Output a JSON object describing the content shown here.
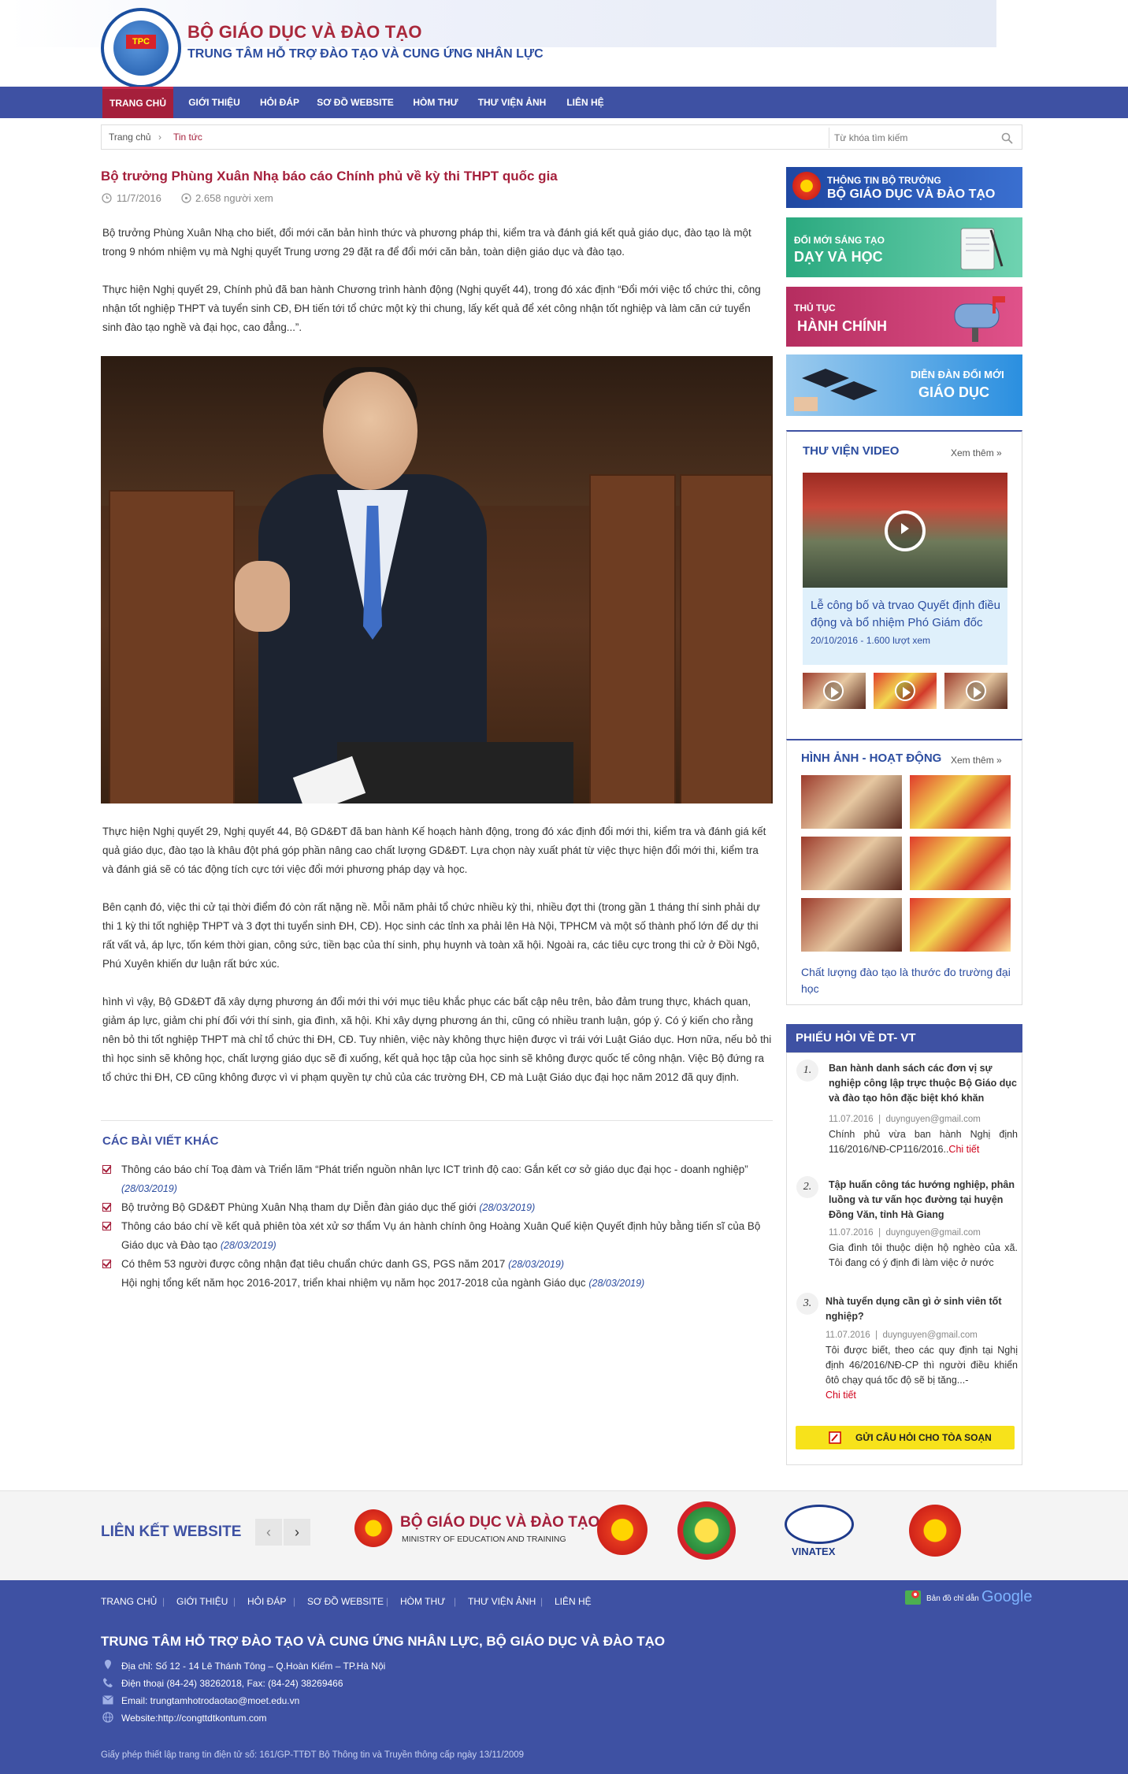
{
  "header": {
    "title": "BỘ GIÁO DỤC VÀ ĐÀO TẠO",
    "subtitle": "TRUNG TÂM HỖ TRỢ ĐÀO TẠO VÀ CUNG ỨNG NHÂN LỰC",
    "logo_text": "TPC"
  },
  "nav": {
    "items": [
      "TRANG CHỦ",
      "GIỚI THIỆU",
      "HỎI ĐÁP",
      "SƠ ĐỒ WEBSITE",
      "HÒM THƯ",
      "THƯ VIỆN ẢNH",
      "LIÊN HỆ"
    ],
    "active": "TRANG CHỦ"
  },
  "breadcrumb": {
    "home": "Trang chủ",
    "sep": "›",
    "current": "Tin tức"
  },
  "search": {
    "placeholder": "Từ khóa tìm kiếm"
  },
  "article": {
    "title": "Bộ trưởng Phùng Xuân Nhạ báo cáo Chính phủ về kỳ thi THPT quốc gia",
    "date": "11/7/2016",
    "views": "2.658 người xem",
    "p1": "Bộ trưởng Phùng Xuân Nhạ cho biết, đổi mới căn bản hình thức và phương pháp thi, kiểm tra và đánh giá kết quả giáo dục, đào tạo là một trong 9 nhóm nhiệm vụ mà Nghị quyết Trung ương 29 đặt ra để đổi mới căn bản, toàn diện giáo dục và đào tạo.",
    "p2": "Thực hiện Nghị quyết 29, Chính phủ đã ban hành Chương trình hành động (Nghị quyết 44), trong đó xác định “Đổi mới việc tổ chức thi, công nhận tốt nghiệp THPT và tuyển sinh CĐ, ĐH tiến tới tổ chức một kỳ thi chung, lấy kết quả để xét công nhận tốt nghiệp và làm căn cứ tuyển sinh đào tạo nghề và đại học, cao đẳng...”.",
    "p3": "Thực hiện Nghị quyết 29, Nghị quyết 44, Bộ GD&ĐT đã ban hành Kế hoạch hành động, trong đó xác định đổi mới thi, kiểm tra và đánh giá kết quả giáo dục, đào tạo là khâu đột phá góp phần nâng cao chất lượng GD&ĐT. Lựa chọn này xuất phát từ việc thực hiện đổi mới thi, kiểm tra và đánh giá sẽ có tác động tích cực tới việc đổi mới phương pháp dạy và học.",
    "p4": "Bên cạnh đó, việc thi cử tại thời điểm đó còn rất nặng nề. Mỗi năm phải tổ chức nhiều kỳ thi, nhiều đợt thi (trong gần 1 tháng thí sinh phải dự thi 1 kỳ thi tốt nghiệp THPT và 3 đợt thi tuyển sinh ĐH, CĐ). Học sinh các tỉnh xa phải lên Hà Nội, TPHCM và một số thành phố lớn để dự thi rất vất vả, áp lực, tốn kém thời gian, công sức, tiền bạc của thí sinh, phụ huynh và toàn xã hội. Ngoài ra, các tiêu cực trong thi cử ở Đồi Ngô, Phú Xuyên khiến dư luận rất bức xúc.",
    "p5": "hình vì vậy, Bộ GD&ĐT đã xây dựng phương án đổi mới thi với mục tiêu khắc phục các bất cập nêu trên, bảo đảm trung thực, khách quan, giảm áp lực, giảm chi phí đối với thí sinh, gia đình, xã hội. Khi xây dựng phương án thi, cũng có nhiều tranh luận, góp ý. Có ý kiến cho rằng nên bỏ thi tốt nghiệp THPT mà chỉ tổ chức thi ĐH, CĐ. Tuy nhiên, việc này không thực hiện được vì trái với Luật Giáo dục. Hơn nữa, nếu bỏ thi thì học sinh sẽ không học, chất lượng giáo dục sẽ đi xuống, kết quả học tập của học sinh sẽ không được quốc tế công nhận. Việc Bộ đứng ra tổ chức thi ĐH, CĐ cũng không được vì vi phạm quyền tự chủ của các trường ĐH, CĐ mà Luật Giáo dục đại học năm 2012 đã quy định."
  },
  "related": {
    "title": "CÁC BÀI VIẾT KHÁC",
    "items": [
      {
        "text": "Thông cáo báo chí Toạ đàm và Triển lãm “Phát triển nguồn nhân lực ICT trình độ cao: Gắn kết cơ sở giáo dục đại học - doanh nghiệp”",
        "date": "(28/03/2019)"
      },
      {
        "text": "Bộ trưởng Bộ GD&ĐT Phùng Xuân Nhạ tham dự Diễn đàn giáo dục thế giới",
        "date": "(28/03/2019)"
      },
      {
        "text": "Thông cáo báo chí về kết quả phiên tòa xét xử sơ thẩm Vụ án hành chính ông Hoàng Xuân Quế kiện Quyết định hủy bằng tiến sĩ của Bộ Giáo dục và Đào tạo",
        "date": "(28/03/2019)"
      },
      {
        "text": "Có thêm 53 người được công nhận đạt tiêu chuẩn chức danh GS, PGS năm 2017",
        "date": "(28/03/2019)"
      },
      {
        "text": "Hội nghị tổng kết năm học 2016-2017, triển khai nhiệm vụ năm học 2017-2018 của ngành Giáo dục",
        "date": "(28/03/2019)"
      }
    ]
  },
  "banners": [
    {
      "small": "THÔNG TIN BỘ TRƯỞNG",
      "big": "BỘ GIÁO DỤC VÀ ĐÀO TẠO",
      "color": "#2d57b0"
    },
    {
      "small": "ĐỔI MỚI SÁNG TẠO",
      "big": "DẠY VÀ HỌC",
      "color": "#33b890"
    },
    {
      "small": "THỦ TỤC",
      "big": "HÀNH CHÍNH",
      "color": "#c73c6e"
    },
    {
      "small": "DIỄN ĐÀN ĐỔI MỚI",
      "big": "GIÁO DỤC",
      "color": "#1f8fd6"
    }
  ],
  "video": {
    "title": "THƯ VIỆN VIDEO",
    "more": "Xem thêm",
    "caption": "Lễ công bố và trvao Quyết định điều động và bổ nhiệm Phó Giám đốc",
    "meta": "20/10/2016 - 1.600 lượt xem"
  },
  "gallery": {
    "title": "HÌNH ẢNH - HOẠT ĐỘNG",
    "more": "Xem thêm",
    "caption": "Chất lượng đào tạo là thước đo trường đại học"
  },
  "faq": {
    "title": "PHIẾU HỎI VỀ DT- VT",
    "items": [
      {
        "num": "1.",
        "q": "Ban hành danh sách các đơn vị sự nghiệp công lập trực thuộc Bộ Giáo dục và đào tạo hôn đặc biệt khó khăn",
        "date": "11.07.2016",
        "email": "duynguyen@gmail.com",
        "a": "Chính phủ vừa ban hành Nghị định 116/2016/NĐ-CP116/2016..",
        "link": "Chi tiết"
      },
      {
        "num": "2.",
        "q": "Tập huấn công tác hướng nghiệp, phân luồng và tư vấn học đường tại huyện Đồng Văn, tỉnh Hà Giang",
        "date": "11.07.2016",
        "email": "duynguyen@gmail.com",
        "a": "Gia đình tôi thuộc diện hộ nghèo của xã. Tôi đang có ý định đi làm việc ở nước",
        "link": ""
      },
      {
        "num": "3.",
        "q": "Nhà tuyển dụng cần gì ở sinh viên tốt nghiệp?",
        "date": "11.07.2016",
        "email": "duynguyen@gmail.com",
        "a": "Tôi được biết, theo các quy định tại Nghị định 46/2016/NĐ-CP thì người điều khiển ôtô chạy quá tốc độ sẽ bị tăng...-",
        "link": "Chi tiết"
      }
    ],
    "ask_button": "GỬI CÂU HỎI CHO TÒA SOẠN"
  },
  "links": {
    "title": "LIÊN KẾT WEBSITE",
    "moet": "BỘ GIÁO DỤC VÀ ĐÀO TẠO",
    "moet_en": "MINISTRY OF EDUCATION AND TRAINING",
    "vinatex": "VINATEX"
  },
  "footer": {
    "nav": [
      "TRANG CHỦ",
      "GIỚI THIỆU",
      "HỎI ĐÁP",
      "SƠ ĐỒ WEBSITE",
      "HÒM THƯ",
      "THƯ VIỆN ẢNH",
      "LIÊN HỆ"
    ],
    "map_text": "Bản đồ chỉ dẫn",
    "google": "Google",
    "title": "TRUNG TÂM HỖ TRỢ ĐÀO TẠO VÀ CUNG ỨNG NHÂN LỰC, BỘ GIÁO DỤC VÀ ĐÀO TẠO",
    "address": "Địa chỉ: Số 12 - 14 Lê Thánh Tông – Q.Hoàn Kiếm – TP.Hà Nội",
    "phone": "Điện thoại (84-24) 38262018, Fax: (84-24) 38269466",
    "email": "Email: trungtamhotrodaotao@moet.edu.vn",
    "website": "Website:http://congttdtkontum.com",
    "license": "Giấy phép thiết lập trang tin điện tử số: 161/GP-TTĐT Bộ Thông tin và Truyền thông cấp ngày 13/11/2009"
  }
}
